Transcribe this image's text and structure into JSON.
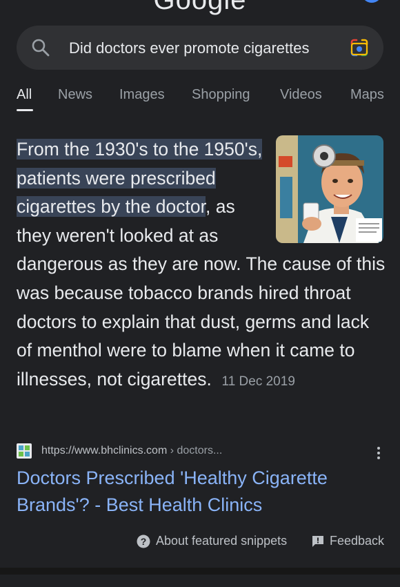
{
  "header": {
    "logo_text": "Google"
  },
  "search": {
    "query": "Did doctors ever promote cigarettes"
  },
  "tabs": [
    {
      "label": "All"
    },
    {
      "label": "News"
    },
    {
      "label": "Images"
    },
    {
      "label": "Shopping"
    },
    {
      "label": "Videos"
    },
    {
      "label": "Maps"
    }
  ],
  "snippet": {
    "highlighted": "From the 1930's to the 1950's, patients were prescribed cigarettes by the doctor",
    "rest": ", as they weren't looked at as dangerous as they are now. The cause of this was because tobacco brands hired throat doctors to explain that dust, germs and lack of menthol were to blame when it came to illnesses, not cigarettes.",
    "date": "11 Dec 2019"
  },
  "result": {
    "url": "https://www.bhclinics.com",
    "breadcrumb": " › doctors...",
    "title": "Doctors Prescribed 'Healthy Cigarette Brands'? - Best Health Clinics"
  },
  "footer": {
    "about_label": "About featured snippets",
    "feedback_label": "Feedback"
  },
  "colors": {
    "background": "#202124",
    "link": "#8ab4f8",
    "highlight": "#394457",
    "muted": "#9aa0a6"
  }
}
